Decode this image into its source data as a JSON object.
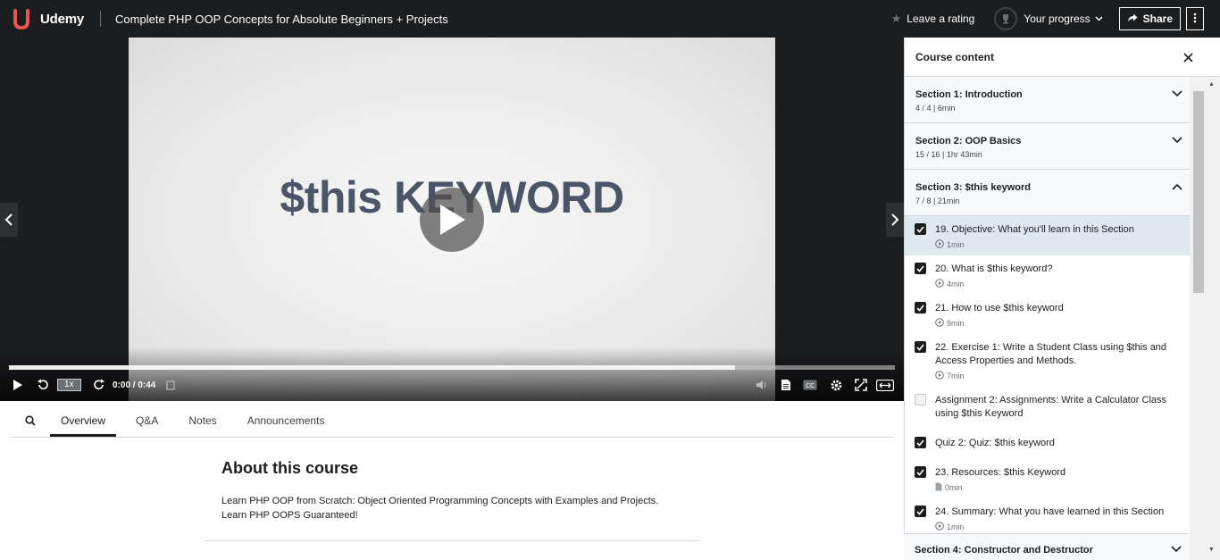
{
  "topbar": {
    "logo_text": "Udemy",
    "course_title": "Complete PHP OOP Concepts for Absolute Beginners + Projects",
    "rating_label": "Leave a rating",
    "progress_label": "Your progress",
    "share_label": "Share"
  },
  "video": {
    "slide_text": "$this KEYWORD",
    "speed": "1x",
    "time": "0:00 / 0:44",
    "progress_fraction": 0.82
  },
  "tabs": [
    "Overview",
    "Q&A",
    "Notes",
    "Announcements"
  ],
  "about": {
    "heading": "About this course",
    "line1": "Learn PHP OOP from Scratch: Object Oriented Programming Concepts with Examples and Projects.",
    "line2": "Learn PHP OOPS Guaranteed!"
  },
  "sidebar": {
    "title": "Course content",
    "sections": [
      {
        "title": "Section 1: Introduction",
        "meta": "4 / 4 | 6min"
      },
      {
        "title": "Section 2: OOP Basics",
        "meta": "15 / 16 | 1hr 43min"
      },
      {
        "title": "Section 3: $this keyword",
        "meta": "7 / 8 | 21min"
      }
    ],
    "lectures": [
      {
        "title": "19. Objective: What you'll learn in this Section",
        "duration": "1min",
        "checked": true,
        "type": "video"
      },
      {
        "title": "20. What is $this keyword?",
        "duration": "4min",
        "checked": true,
        "type": "video"
      },
      {
        "title": "21. How to use $this keyword",
        "duration": "9min",
        "checked": true,
        "type": "video"
      },
      {
        "title": "22. Exercise 1: Write a Student Class using $this and Access Properties and Methods.",
        "duration": "7min",
        "checked": true,
        "type": "video"
      },
      {
        "title": "Assignment 2: Assignments: Write a Calculator Class using $this Keyword",
        "duration": "",
        "checked": false,
        "type": "assignment"
      },
      {
        "title": "Quiz 2: Quiz: $this keyword",
        "duration": "",
        "checked": true,
        "type": "quiz"
      },
      {
        "title": "23. Resources: $this Keyword",
        "duration": "0min",
        "checked": true,
        "type": "file"
      },
      {
        "title": "24. Summary: What you have learned in this Section",
        "duration": "1min",
        "checked": true,
        "type": "video"
      }
    ],
    "next_section": "Section 4: Constructor and Destructor"
  },
  "colors": {
    "topbar_bg": "#1c1d1f",
    "brand": "#a435f0",
    "logo_red": "#ec5252",
    "current_lecture_bg": "#dde9ef"
  }
}
